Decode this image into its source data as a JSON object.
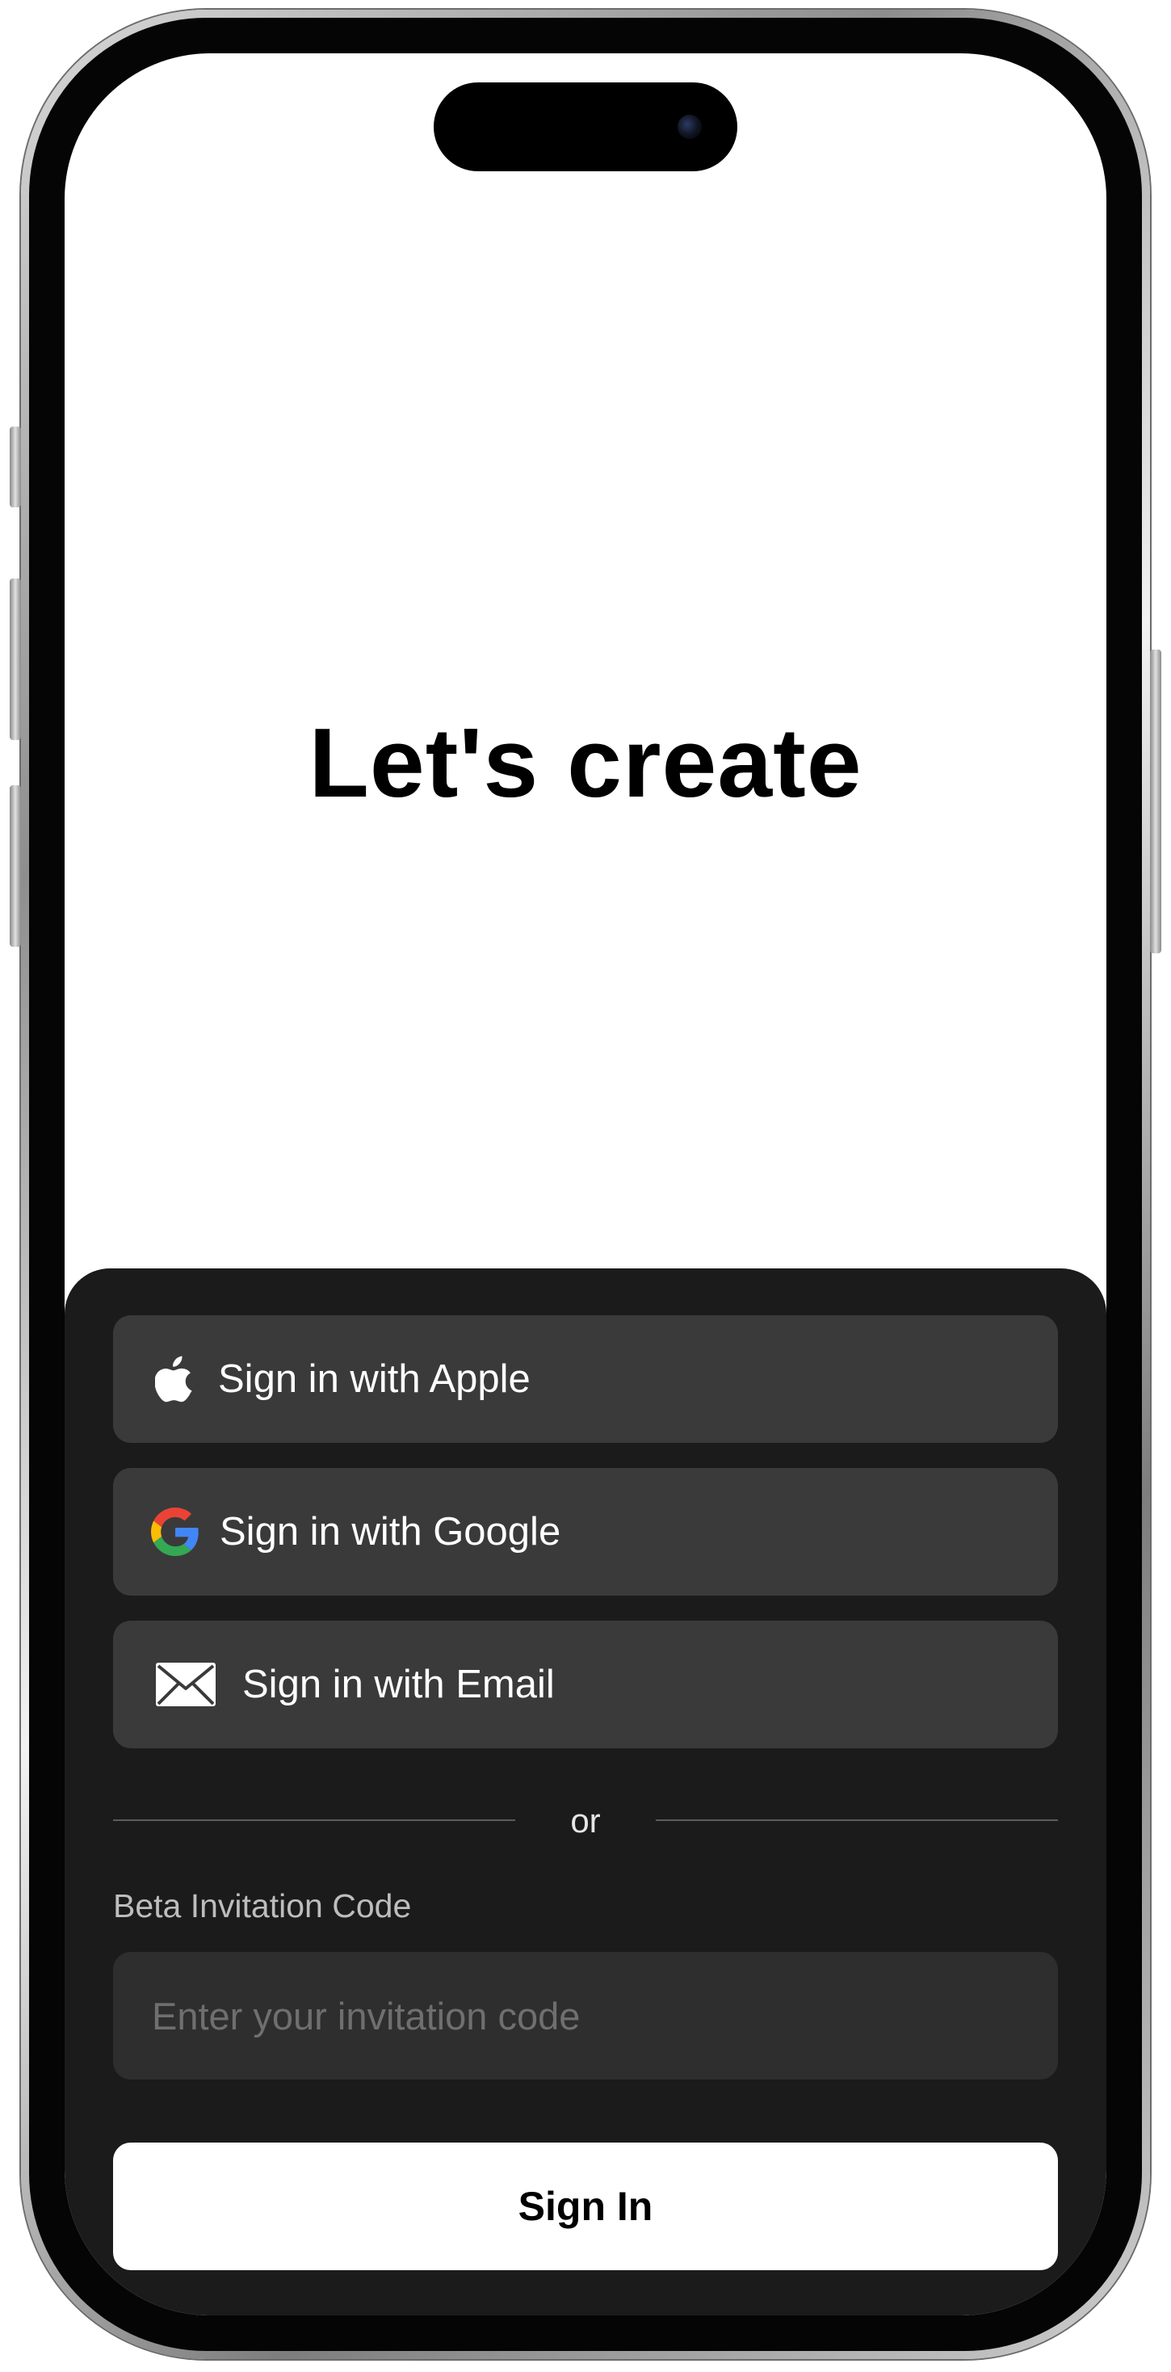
{
  "headline": "Let's create",
  "auth_buttons": [
    {
      "label": "Sign in with Apple",
      "icon": "apple-icon"
    },
    {
      "label": "Sign in with Google",
      "icon": "google-icon"
    },
    {
      "label": "Sign in with Email",
      "icon": "mail-icon"
    }
  ],
  "divider_text": "or",
  "invitation": {
    "label": "Beta Invitation Code",
    "placeholder": "Enter your invitation code",
    "value": ""
  },
  "sign_in_label": "Sign In",
  "colors": {
    "sheet_background": "#1b1b1b",
    "button_background": "#3a3a3a",
    "input_background": "#2e2e2e",
    "primary_button": "#ffffff",
    "google_blue": "#4285F4",
    "google_red": "#EA4335",
    "google_yellow": "#FBBC05",
    "google_green": "#34A853"
  }
}
